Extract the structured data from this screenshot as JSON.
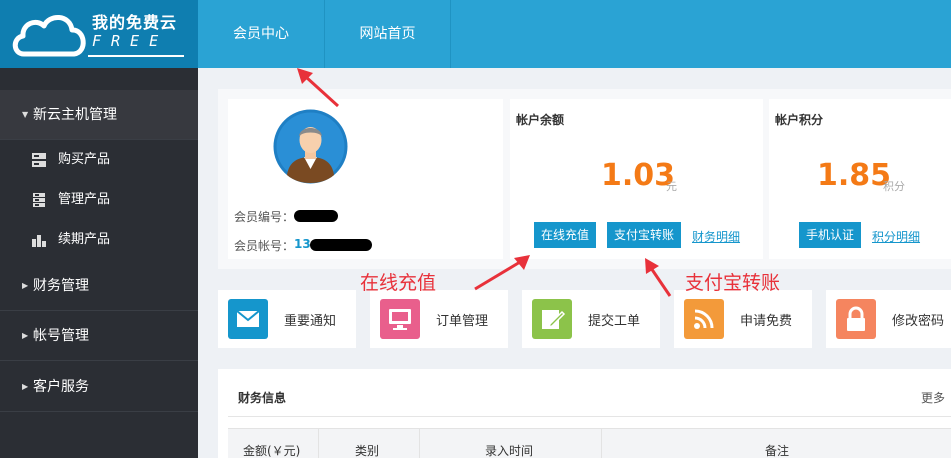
{
  "logo": {
    "cn": "我的免费云",
    "en": "FREE"
  },
  "nav": {
    "member_center": "会员中心",
    "home": "网站首页"
  },
  "sidebar": {
    "groups": [
      {
        "label": "新云主机管理",
        "expanded": true
      },
      {
        "label": "财务管理"
      },
      {
        "label": "帐号管理"
      },
      {
        "label": "客户服务"
      }
    ],
    "subitems": [
      {
        "label": "购买产品",
        "icon": "server-icon"
      },
      {
        "label": "管理产品",
        "icon": "server-stack-icon"
      },
      {
        "label": "续期产品",
        "icon": "bar-chart-icon"
      }
    ]
  },
  "user": {
    "id_label": "会员编号：",
    "account_label": "会员帐号：",
    "account_prefix": "13"
  },
  "balance": {
    "title": "帐户余额",
    "amount": "1.03",
    "unit": "元",
    "recharge_btn": "在线充值",
    "alipay_btn": "支付宝转账",
    "detail_link": "财务明细"
  },
  "points": {
    "title": "帐户积分",
    "amount": "1.85",
    "unit": "积分",
    "verify_btn": "手机认证",
    "detail_link": "积分明细"
  },
  "tiles": [
    {
      "label": "重要通知",
      "icon": "mail-icon",
      "color": "#1596cc"
    },
    {
      "label": "订单管理",
      "icon": "monitor-icon",
      "color": "#e95f8c"
    },
    {
      "label": "提交工单",
      "icon": "edit-icon",
      "color": "#8cc34a"
    },
    {
      "label": "申请免费",
      "icon": "rss-icon",
      "color": "#f39a3a"
    },
    {
      "label": "修改密码",
      "icon": "lock-icon",
      "color": "#f5855f"
    }
  ],
  "finance": {
    "title": "财务信息",
    "more": "更多",
    "columns": [
      "金额(￥元)",
      "类别",
      "录入时间",
      "备注"
    ]
  },
  "annotations": {
    "recharge": "在线充值",
    "alipay": "支付宝转账"
  }
}
